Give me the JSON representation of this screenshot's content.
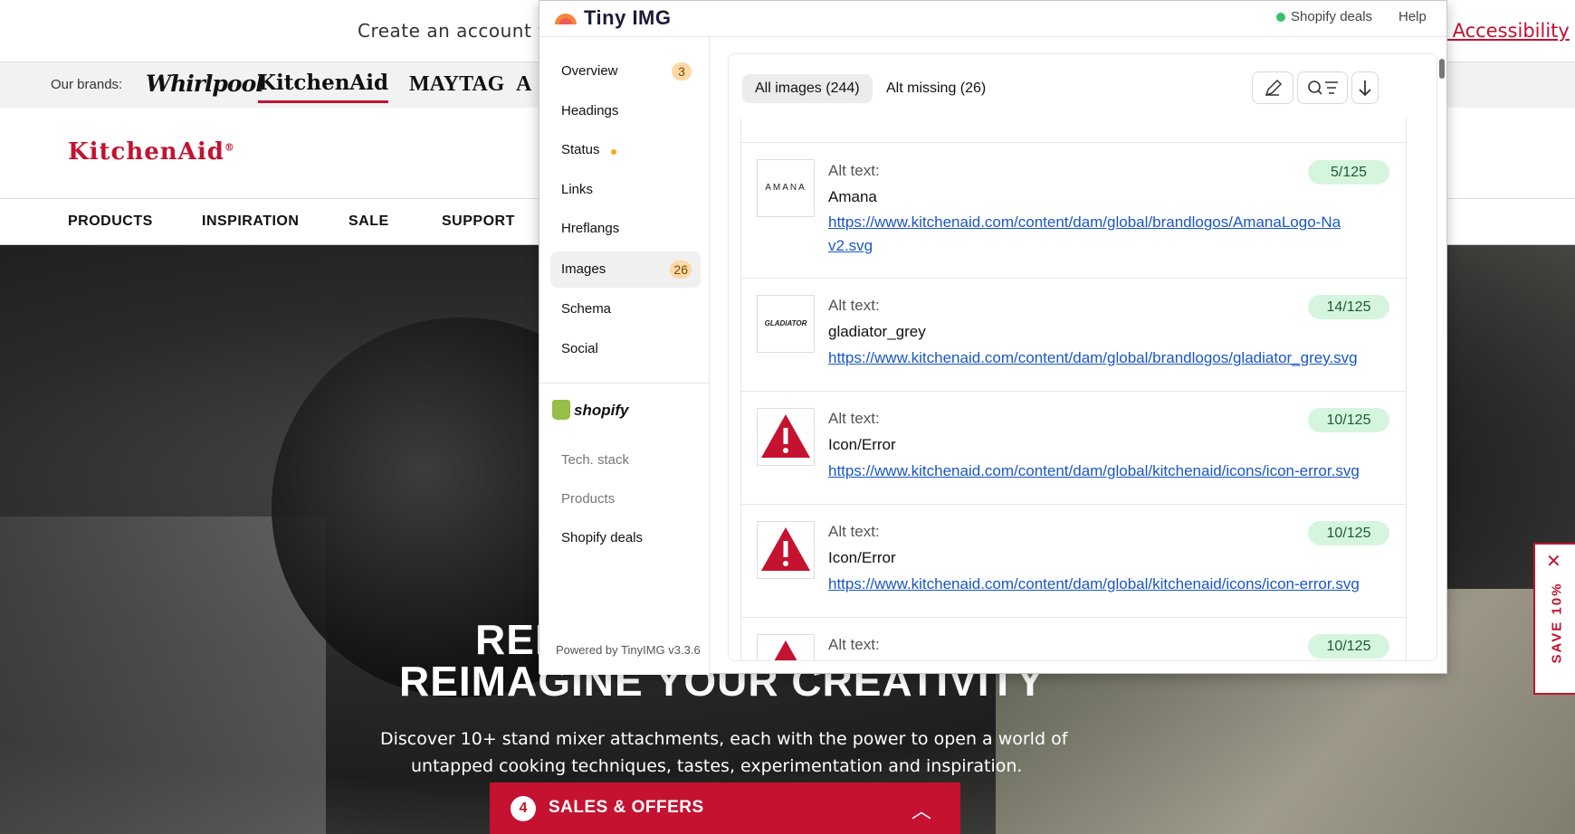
{
  "site": {
    "promo_text": "Create an account to u",
    "accessibility": "e Accessibility",
    "brands_label": "Our brands:",
    "brands": [
      "Whirlpool",
      "KitchenAid",
      "MAYTAG",
      "A"
    ],
    "logo": "KitchenAid",
    "logo_mark": "®",
    "nav": [
      "PRODUCTS",
      "INSPIRATION",
      "SALE",
      "SUPPORT"
    ],
    "hero": {
      "title_line1": "REI",
      "title_line2": "REIMAGINE YOUR CREATIVITY",
      "desc_line1": "Discover 10+ stand mixer attachments, each with the power to open a world of",
      "desc_line2": "untapped cooking techniques, tastes, experimentation and inspiration."
    },
    "sales": {
      "count": "4",
      "label": "SALES & OFFERS"
    },
    "save_tab": "SAVE 10%"
  },
  "tinyimg": {
    "brand": "Tiny IMG",
    "header_links": {
      "deals": "Shopify deals",
      "help": "Help"
    },
    "sidebar": [
      {
        "label": "Overview",
        "badge": "3"
      },
      {
        "label": "Headings"
      },
      {
        "label": "Status",
        "dot": true
      },
      {
        "label": "Links"
      },
      {
        "label": "Hreflangs"
      },
      {
        "label": "Images",
        "badge": "26",
        "active": true
      },
      {
        "label": "Schema"
      },
      {
        "label": "Social"
      }
    ],
    "shopify_label": "shopify",
    "shopify_items": [
      "Tech. stack",
      "Products",
      "Shopify deals"
    ],
    "powered": "Powered by TinyIMG v3.3.6",
    "tabs": {
      "all": "All images (244)",
      "missing": "Alt missing (26)"
    },
    "alt_label": "Alt text:",
    "images": [
      {
        "thumb": "AMANA",
        "alt": "Amana",
        "count": "5/125",
        "url": "https://www.kitchenaid.com/content/dam/global/brandlogos/AmanaLogo-Nav2.svg"
      },
      {
        "thumb": "GLADIATOR",
        "alt": "gladiator_grey",
        "count": "14/125",
        "url": "https://www.kitchenaid.com/content/dam/global/brandlogos/gladiator_grey.svg"
      },
      {
        "thumb": "error",
        "alt": "Icon/Error",
        "count": "10/125",
        "url": "https://www.kitchenaid.com/content/dam/global/kitchenaid/icons/icon-error.svg"
      },
      {
        "thumb": "error",
        "alt": "Icon/Error",
        "count": "10/125",
        "url": "https://www.kitchenaid.com/content/dam/global/kitchenaid/icons/icon-error.svg"
      },
      {
        "thumb": "error",
        "alt": "",
        "count": "10/125",
        "url": ""
      }
    ]
  }
}
